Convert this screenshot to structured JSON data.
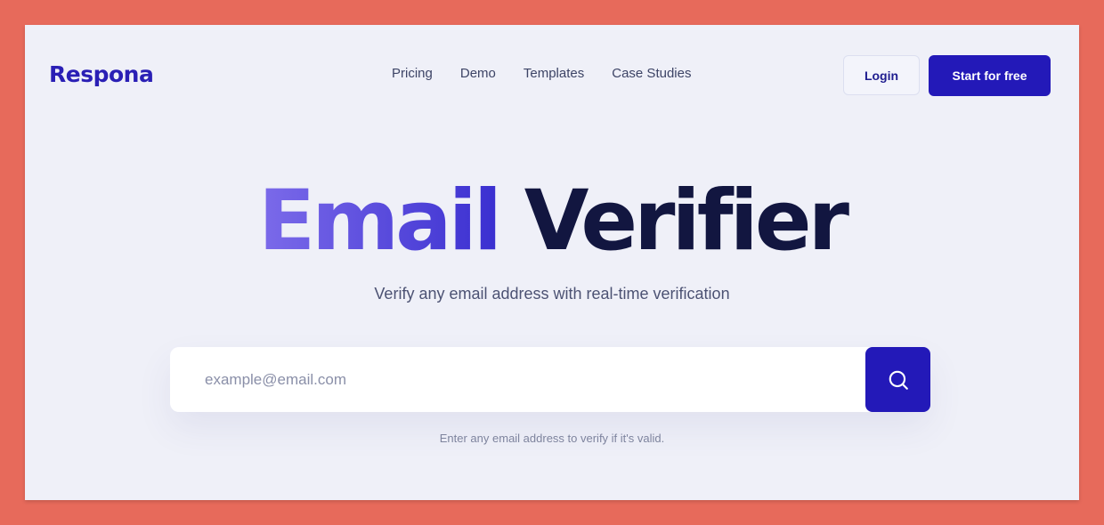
{
  "brand": {
    "logo_text": "Respona",
    "accent_color": "#2319b8"
  },
  "nav": {
    "items": [
      {
        "label": "Pricing"
      },
      {
        "label": "Demo"
      },
      {
        "label": "Templates"
      },
      {
        "label": "Case Studies"
      }
    ]
  },
  "header_actions": {
    "login_label": "Login",
    "start_label": "Start for free"
  },
  "hero": {
    "title_part1": "Email",
    "title_part2": "Verifier",
    "subtitle": "Verify any email address with real-time verification"
  },
  "search": {
    "placeholder": "example@email.com",
    "value": "",
    "button_icon": "search-icon",
    "hint": "Enter any email address to verify if it's valid."
  }
}
